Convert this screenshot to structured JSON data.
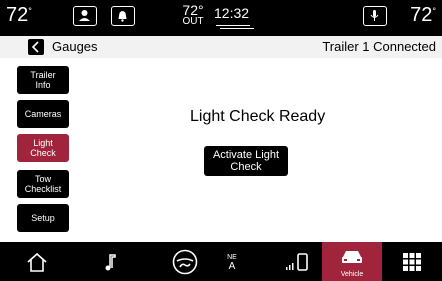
{
  "status_bar": {
    "temp_left": "72",
    "temp_left_unit": "°",
    "outside_temp": "72°",
    "outside_label": "OUT",
    "clock": "12:32",
    "temp_right": "72",
    "temp_right_unit": "°"
  },
  "header": {
    "title": "Gauges",
    "status": "Trailer 1 Connected"
  },
  "sidebar": {
    "items": [
      {
        "label": "Trailer Info"
      },
      {
        "label": "Cameras"
      },
      {
        "label": "Light Check",
        "active": true
      },
      {
        "label": "Tow Checklist"
      },
      {
        "label": "Setup"
      }
    ]
  },
  "main": {
    "status_text": "Light Check Ready",
    "activate_label": "Activate Light Check"
  },
  "nav": {
    "compass_ne": "NE",
    "compass_a": "A",
    "vehicle_label": "Vehicle"
  },
  "colors": {
    "accent": "#a0243b",
    "background": "#000000",
    "content_bg": "#ffffff"
  }
}
